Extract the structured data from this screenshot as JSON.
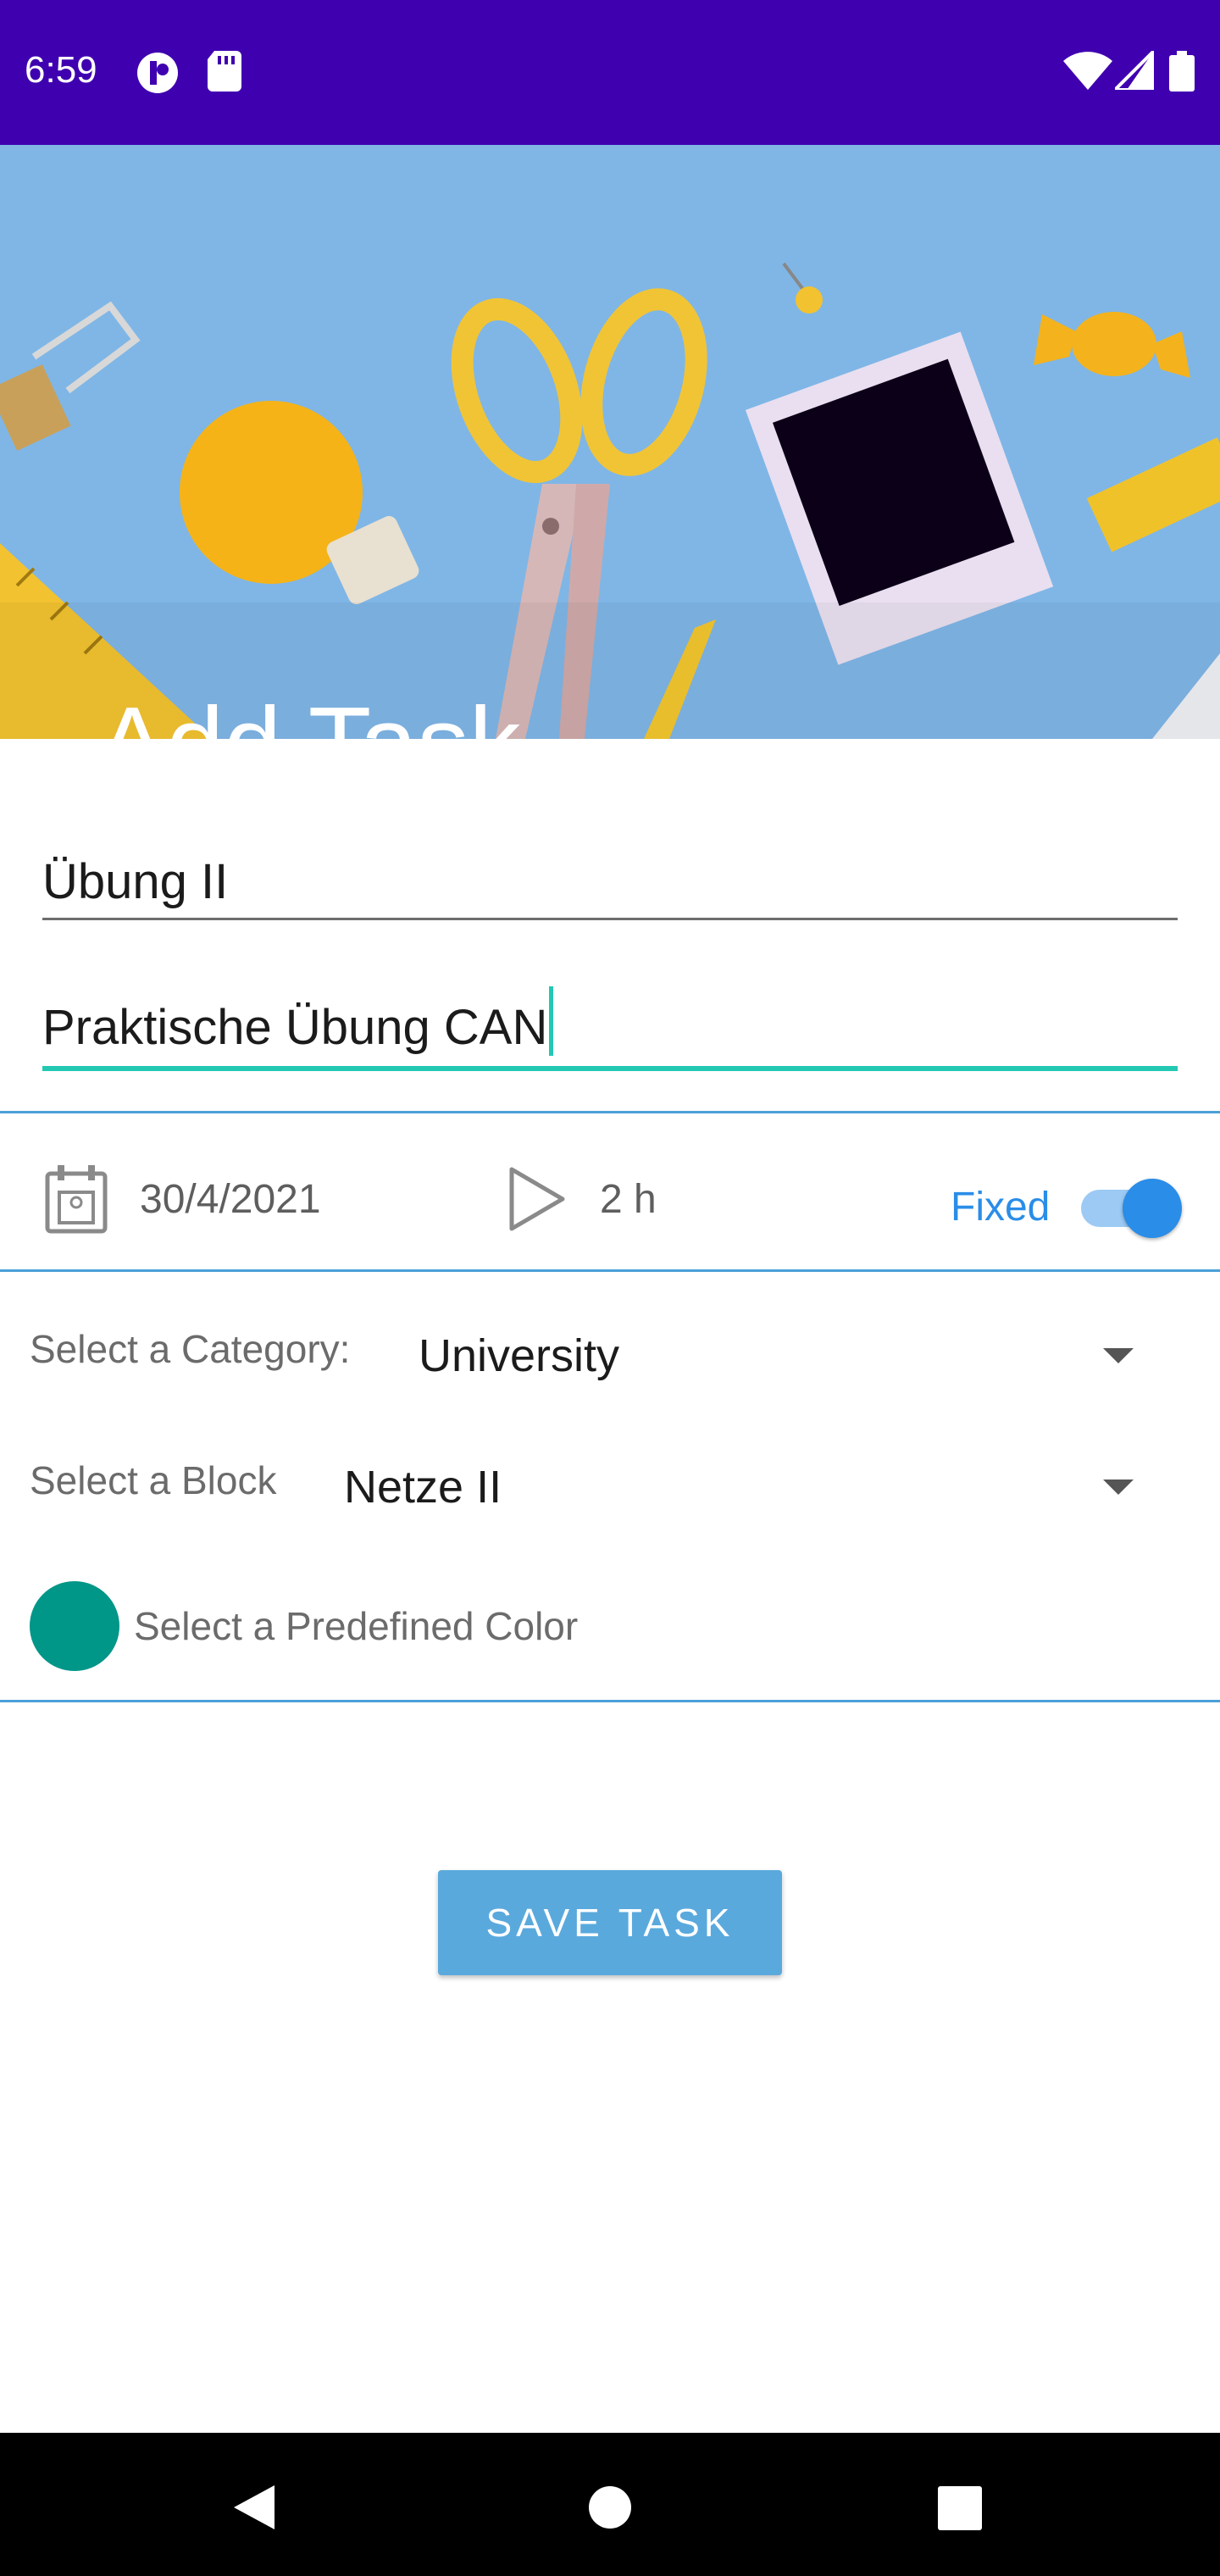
{
  "status_bar": {
    "time": "6:59",
    "icons_left": [
      "circle-badge-icon",
      "sd-card-icon"
    ],
    "icons_right": [
      "wifi-icon",
      "signal-icon",
      "battery-icon"
    ],
    "background": "#3f00b0"
  },
  "header": {
    "title": "Add Task"
  },
  "form": {
    "task_name": "Übung II",
    "task_description": "Praktische Übung CAN",
    "date": "30/4/2021",
    "duration": "2 h",
    "fixed_label": "Fixed",
    "fixed_enabled": true,
    "category_label": "Select a Category:",
    "category_value": "University",
    "block_label": "Select a Block",
    "block_value": "Netze II",
    "color_label": "Select a Predefined Color",
    "color_value": "#009688"
  },
  "actions": {
    "save_label": "SAVE TASK"
  },
  "nav_bar": {
    "buttons": [
      "back-icon",
      "home-icon",
      "recents-icon"
    ]
  }
}
